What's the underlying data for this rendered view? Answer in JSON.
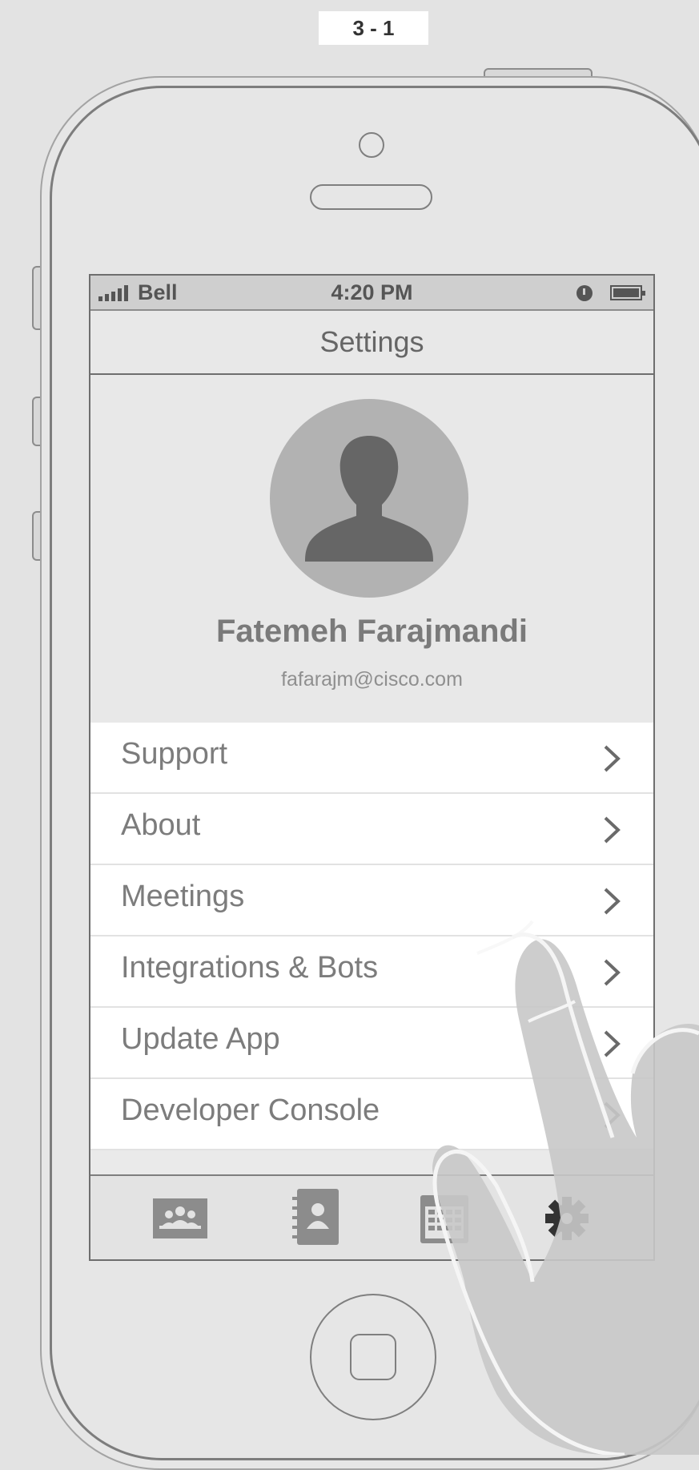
{
  "frame_label": "3 - 1",
  "status_bar": {
    "carrier": "Bell",
    "time": "4:20 PM"
  },
  "nav": {
    "title": "Settings"
  },
  "profile": {
    "name": "Fatemeh Farajmandi",
    "email": "fafarajm@cisco.com"
  },
  "menu": {
    "items": [
      {
        "label": "Support"
      },
      {
        "label": "About"
      },
      {
        "label": "Meetings"
      },
      {
        "label": "Integrations & Bots"
      },
      {
        "label": "Update App"
      },
      {
        "label": "Developer Console"
      }
    ]
  },
  "tabs": [
    {
      "icon": "people-icon"
    },
    {
      "icon": "contacts-book-icon"
    },
    {
      "icon": "calendar-icon"
    },
    {
      "icon": "gear-icon",
      "selected": true
    }
  ],
  "colors": {
    "background": "#e3e3e3",
    "screen": "#eaeaea",
    "active_tab": "#333333",
    "inactive_tab": "#8c8c8c"
  }
}
